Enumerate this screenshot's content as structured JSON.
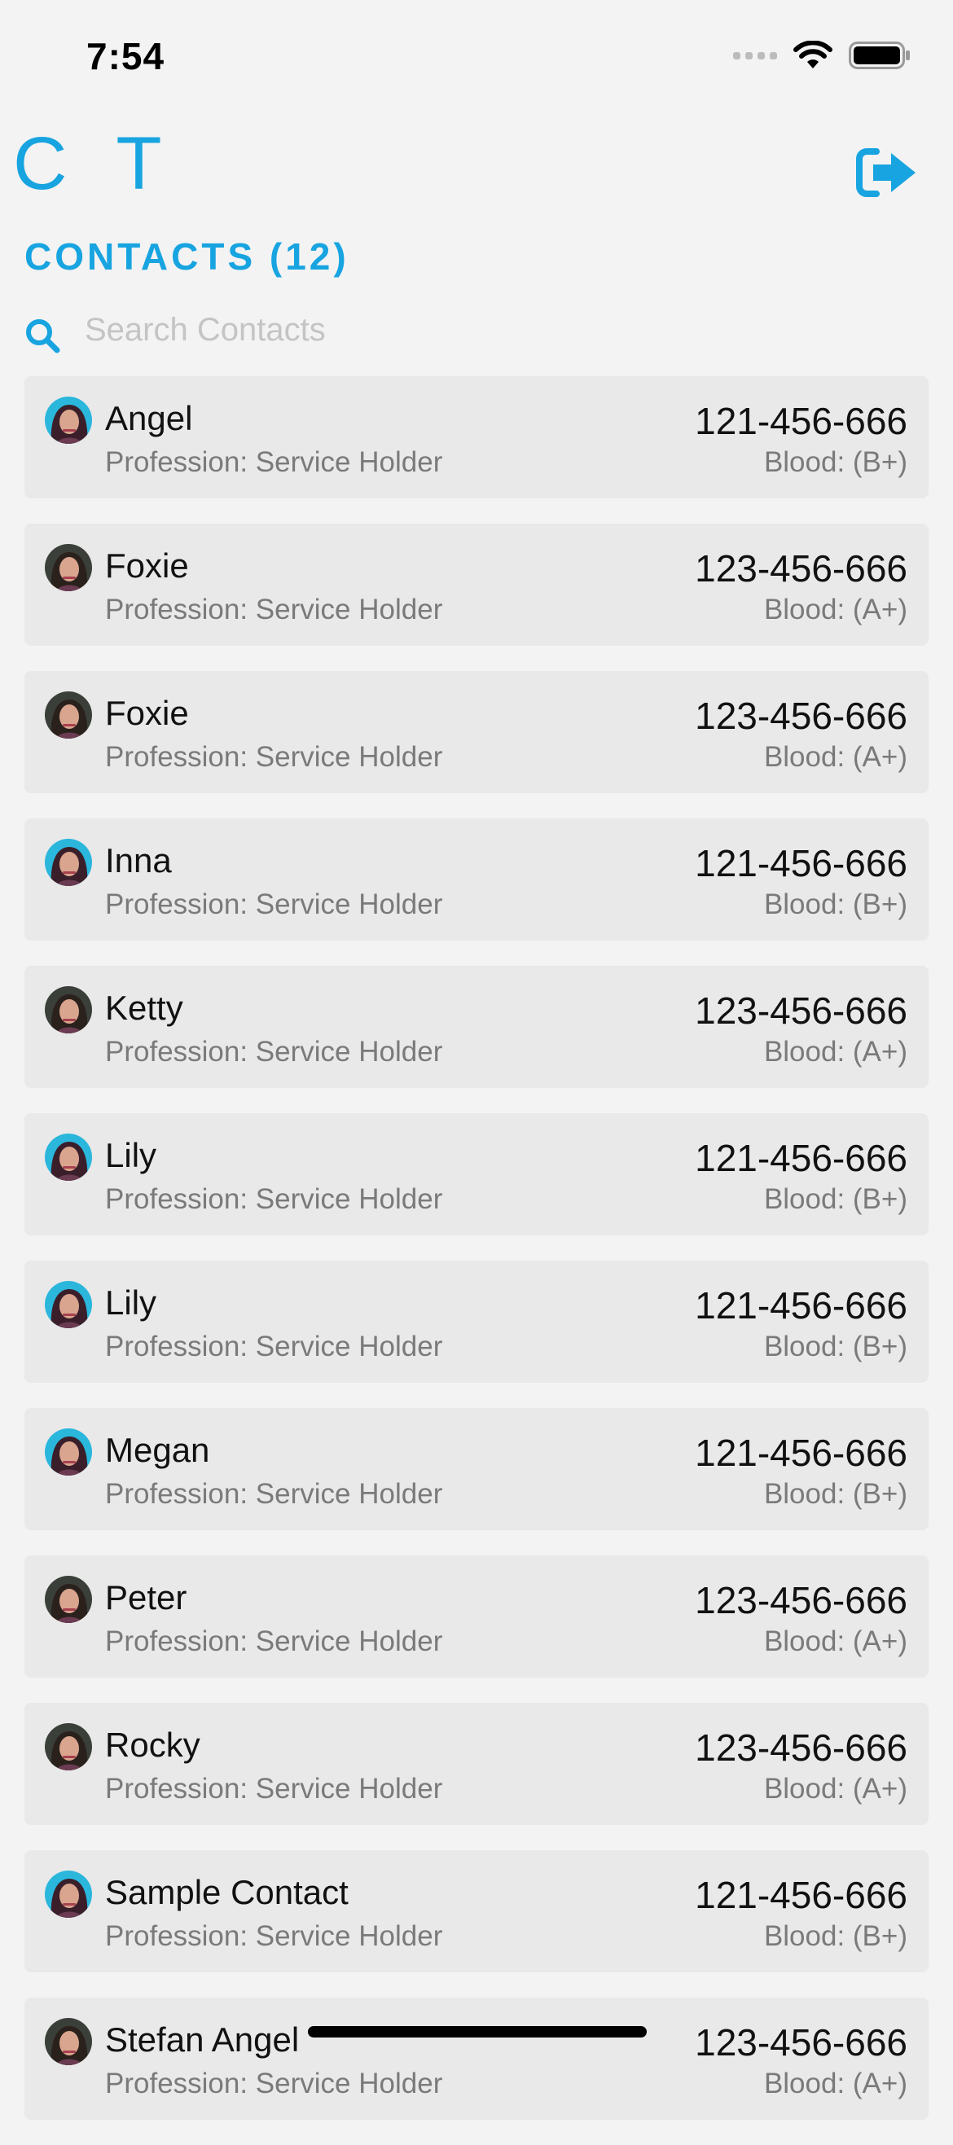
{
  "status_bar": {
    "time": "7:54"
  },
  "app": {
    "logo": "C T",
    "accent_color": "#17a4e0"
  },
  "header": {
    "logout_icon": "logout-arrow-icon"
  },
  "contacts": {
    "title": "CONTACTS (12)"
  },
  "search": {
    "placeholder": "Search Contacts",
    "value": ""
  },
  "list": [
    {
      "name": "Angel",
      "profession": "Profession: Service Holder",
      "phone": "121-456-666",
      "blood": "Blood: (B+)",
      "avatar": "blue"
    },
    {
      "name": "Foxie",
      "profession": "Profession: Service Holder",
      "phone": "123-456-666",
      "blood": "Blood: (A+)",
      "avatar": "dark"
    },
    {
      "name": "Foxie",
      "profession": "Profession: Service Holder",
      "phone": "123-456-666",
      "blood": "Blood: (A+)",
      "avatar": "dark"
    },
    {
      "name": "Inna",
      "profession": "Profession: Service Holder",
      "phone": "121-456-666",
      "blood": "Blood: (B+)",
      "avatar": "blue"
    },
    {
      "name": "Ketty",
      "profession": "Profession: Service Holder",
      "phone": "123-456-666",
      "blood": "Blood: (A+)",
      "avatar": "dark"
    },
    {
      "name": "Lily",
      "profession": "Profession: Service Holder",
      "phone": "121-456-666",
      "blood": "Blood: (B+)",
      "avatar": "blue"
    },
    {
      "name": "Lily",
      "profession": "Profession: Service Holder",
      "phone": "121-456-666",
      "blood": "Blood: (B+)",
      "avatar": "blue"
    },
    {
      "name": "Megan",
      "profession": "Profession: Service Holder",
      "phone": "121-456-666",
      "blood": "Blood: (B+)",
      "avatar": "blue"
    },
    {
      "name": "Peter",
      "profession": "Profession: Service Holder",
      "phone": "123-456-666",
      "blood": "Blood: (A+)",
      "avatar": "dark"
    },
    {
      "name": "Rocky",
      "profession": "Profession: Service Holder",
      "phone": "123-456-666",
      "blood": "Blood: (A+)",
      "avatar": "dark"
    },
    {
      "name": "Sample Contact",
      "profession": "Profession: Service Holder",
      "phone": "121-456-666",
      "blood": "Blood: (B+)",
      "avatar": "blue"
    },
    {
      "name": "Stefan Angel",
      "profession": "Profession: Service Holder",
      "phone": "123-456-666",
      "blood": "Blood: (A+)",
      "avatar": "dark"
    }
  ]
}
